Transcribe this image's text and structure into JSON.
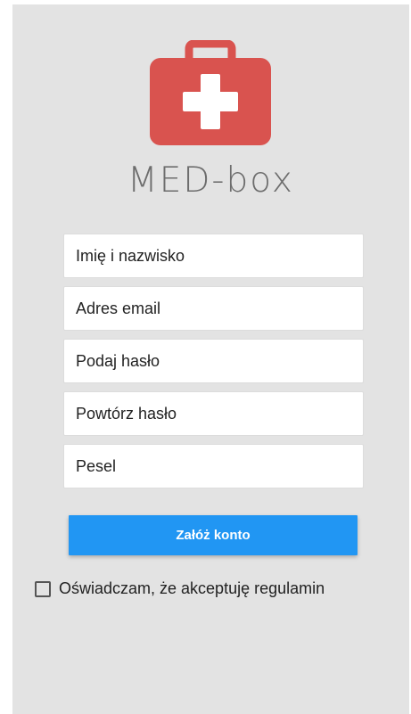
{
  "app": {
    "brand_name": "MED-box",
    "logo_icon": "first-aid-kit-icon",
    "logo_color": "#d9534f"
  },
  "form": {
    "fields": [
      {
        "placeholder": "Imię i nazwisko"
      },
      {
        "placeholder": "Adres email"
      },
      {
        "placeholder": "Podaj hasło"
      },
      {
        "placeholder": "Powtórz hasło"
      },
      {
        "placeholder": "Pesel"
      }
    ],
    "submit_label": "Załóż konto",
    "submit_color": "#2196f3",
    "terms_label": "Oświadczam, że akceptuję regulamin",
    "terms_checked": false
  }
}
